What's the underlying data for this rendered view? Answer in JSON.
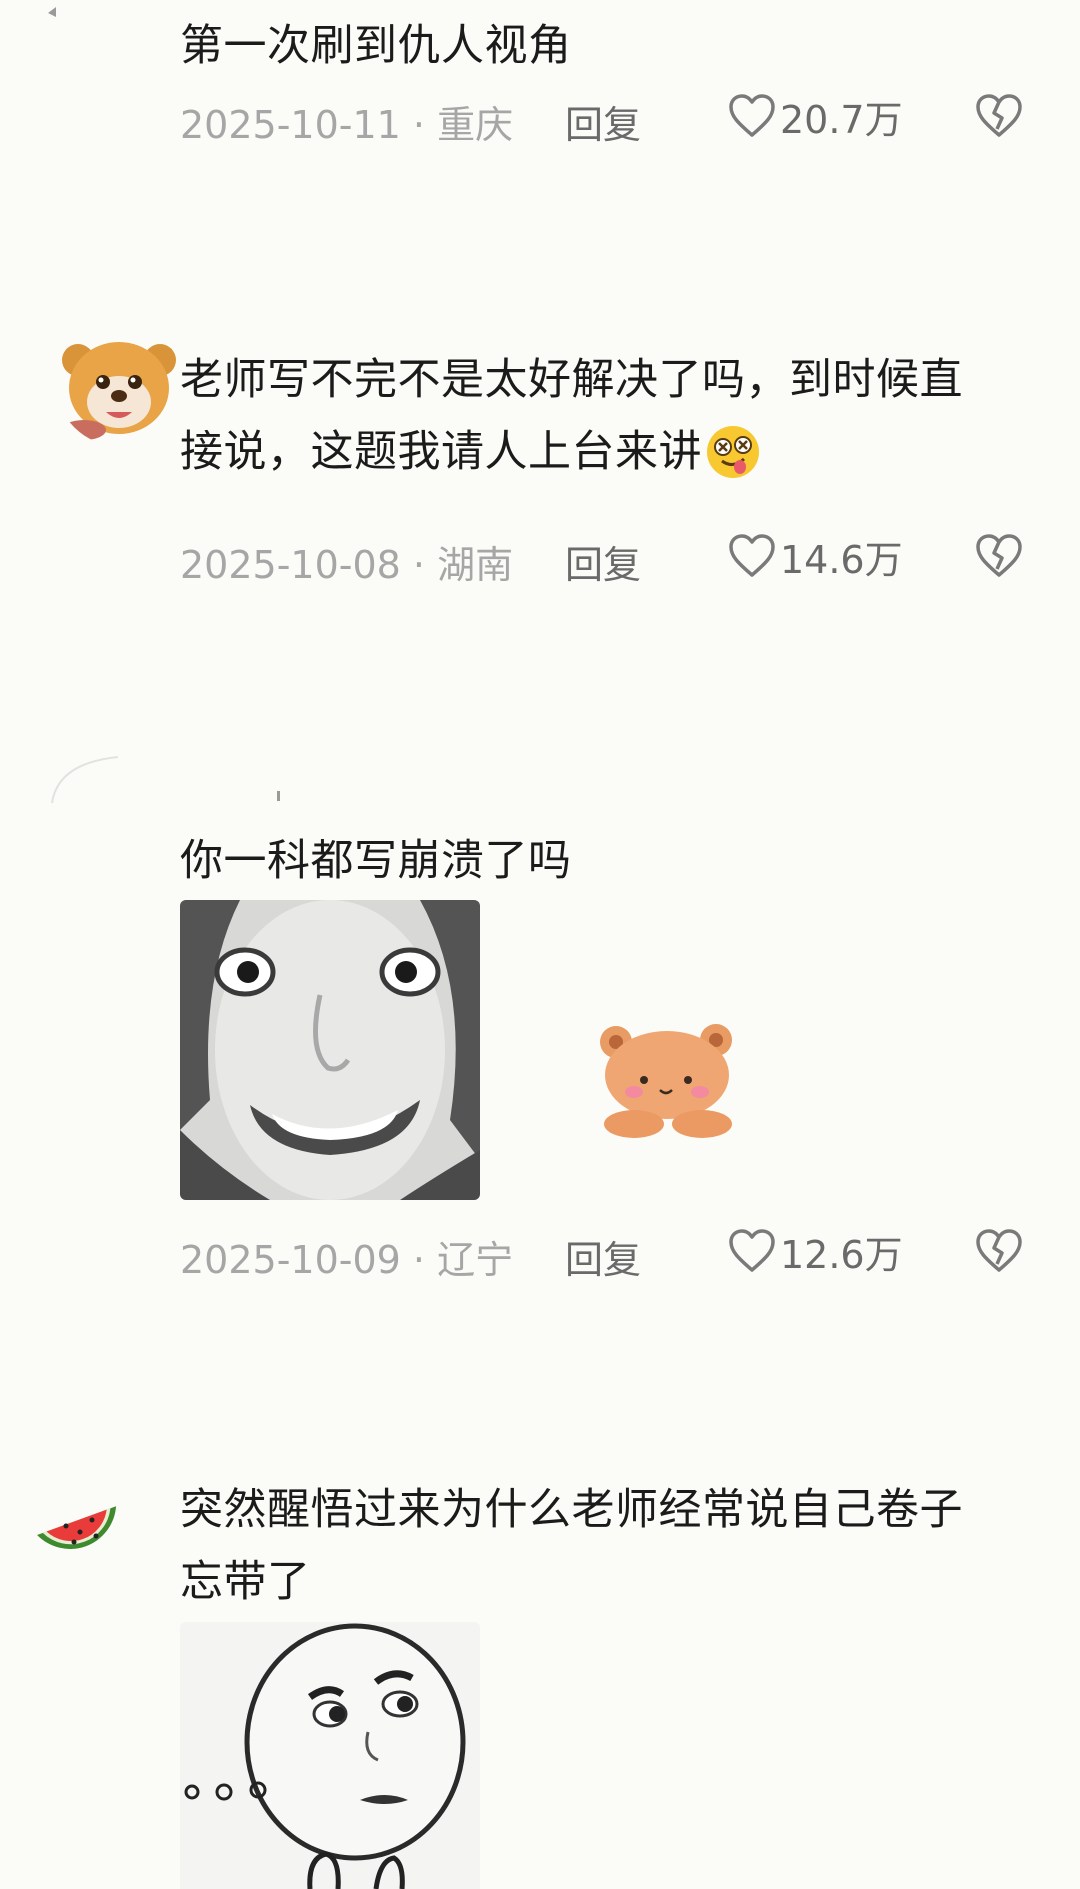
{
  "comments": [
    {
      "text": "第一次刷到仇人视角",
      "date_location": "2025-10-11 · 重庆",
      "reply_label": "回复",
      "likes": "20.7万"
    },
    {
      "text_line1": "老师写不完不是太好解决了吗，到时候直",
      "text_line2": "接说，这题我请人上台来讲",
      "date_location": "2025-10-08 · 湖南",
      "reply_label": "回复",
      "likes": "14.6万"
    },
    {
      "text": "你一科都写崩溃了吗",
      "date_location": "2025-10-09 · 辽宁",
      "reply_label": "回复",
      "likes": "12.6万"
    },
    {
      "text_line1": "突然醒悟过来为什么老师经常说自己卷子",
      "text_line2": "忘带了"
    }
  ],
  "icons": {
    "like": "heart-outline-icon",
    "dislike": "broken-heart-icon",
    "emoji": "dizzy-eyes-tongue-emoji"
  },
  "colors": {
    "text": "#1b1b1b",
    "meta": "#a6a6a6",
    "background": "#fbfbf8"
  }
}
